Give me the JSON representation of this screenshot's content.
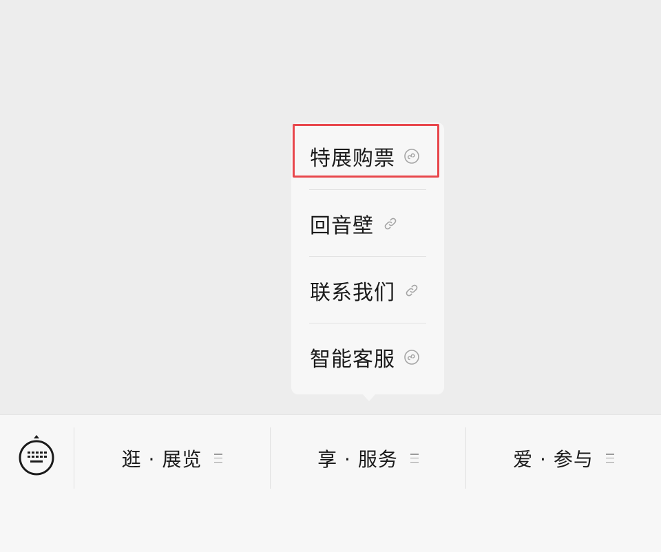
{
  "popup_menu": {
    "items": [
      {
        "label": "特展购票",
        "icon": "mini-program-icon"
      },
      {
        "label": "回音壁",
        "icon": "link-icon"
      },
      {
        "label": "联系我们",
        "icon": "link-icon"
      },
      {
        "label": "智能客服",
        "icon": "mini-program-icon"
      }
    ],
    "highlight_color": "#e8474c"
  },
  "bottom_bar": {
    "keyboard_icon": "keyboard-icon",
    "tabs": [
      {
        "label": "逛 · 展览",
        "icon": "menu-lines-icon"
      },
      {
        "label": "享 · 服务",
        "icon": "menu-lines-icon"
      },
      {
        "label": "爱 · 参与",
        "icon": "menu-lines-icon"
      }
    ]
  }
}
